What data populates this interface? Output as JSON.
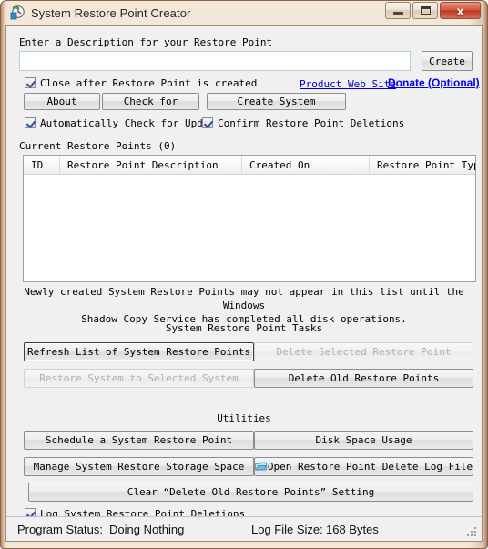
{
  "window": {
    "title": "System Restore Point Creator",
    "icon": "restore-clock-icon",
    "minimize_label": "—",
    "maximize_label": "□",
    "close_label": "x",
    "border_color": "#a97b5c",
    "client_bg": "#f0f0f0"
  },
  "description": {
    "label": "Enter a Description for your Restore Point",
    "input_value": "",
    "input_placeholder": "",
    "create_label": "Create"
  },
  "options": {
    "close_after_label": "Close after Restore Point is created",
    "close_after_checked": true,
    "auto_check_label": "Automatically Check for Updates",
    "auto_check_checked": true,
    "confirm_delete_label": "Confirm Restore Point Deletions",
    "confirm_delete_checked": true
  },
  "links": {
    "product_site": "Product Web Site",
    "donate": "Donate (Optional)",
    "product_site_color": "#0000cd",
    "donate_color": "#0000ee"
  },
  "toolbar": {
    "about_label": "About",
    "check_for_label": "Check for",
    "create_system_label": "Create System"
  },
  "list": {
    "title": "Current Restore Points (0)",
    "columns": [
      "ID",
      "Restore Point Description",
      "Created On",
      "Restore Point Type"
    ],
    "rows": [],
    "info_line1": "Newly created System Restore Points may not appear in this list until the Windows",
    "info_line2": "Shadow Copy Service has completed all disk operations."
  },
  "tasks": {
    "heading": "System Restore Point Tasks",
    "refresh_label": "Refresh List of System Restore Points",
    "delete_selected_label": "Delete Selected Restore Point",
    "restore_system_label": "Restore System to Selected System",
    "delete_old_label": "Delete Old Restore Points"
  },
  "utilities": {
    "heading": "Utilities",
    "schedule_label": "Schedule a System Restore Point",
    "disk_space_label": "Disk Space Usage",
    "manage_storage_label": "Manage System Restore Storage Space",
    "open_log_label": "Open Restore Point Delete Log File",
    "open_log_icon": "log-file-icon",
    "clear_setting_label": "Clear “Delete Old Restore Points” Setting",
    "log_deletions_label": "Log System Restore Point Deletions",
    "log_deletions_checked": true
  },
  "statusbar": {
    "program_status_label": "Program Status:",
    "program_status_value": "Doing Nothing",
    "log_size_label": "Log File Size:",
    "log_size_value": "168 Bytes"
  }
}
